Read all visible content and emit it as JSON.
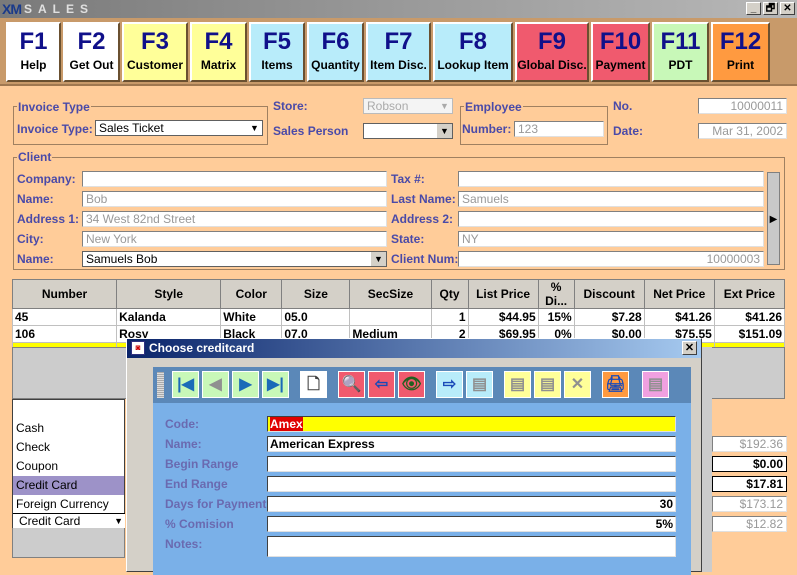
{
  "window": {
    "logo": "XM",
    "title": "SALES",
    "controls": [
      "_",
      "🗗",
      "✕"
    ]
  },
  "fkeys": [
    {
      "key": "F1",
      "label": "Help",
      "color": "#ffffff"
    },
    {
      "key": "F2",
      "label": "Get Out",
      "color": "#ffffff"
    },
    {
      "key": "F3",
      "label": "Customer",
      "color": "#ffff99"
    },
    {
      "key": "F4",
      "label": "Matrix",
      "color": "#ffff99"
    },
    {
      "key": "F5",
      "label": "Items",
      "color": "#b8ecfa"
    },
    {
      "key": "F6",
      "label": "Quantity",
      "color": "#b8ecfa"
    },
    {
      "key": "F7",
      "label": "Item Disc.",
      "color": "#b8ecfa"
    },
    {
      "key": "F8",
      "label": "Lookup Item",
      "color": "#b8ecfa"
    },
    {
      "key": "F9",
      "label": "Global Disc.",
      "color": "#f05a6e"
    },
    {
      "key": "F10",
      "label": "Payment",
      "color": "#f05a6e"
    },
    {
      "key": "F11",
      "label": "PDT",
      "color": "#c8f8b8"
    },
    {
      "key": "F12",
      "label": "Print",
      "color": "#ff9a40"
    }
  ],
  "header": {
    "invoice_group_title": "Invoice Type",
    "invoice_type_label": "Invoice Type:",
    "invoice_type_value": "Sales Ticket",
    "store_label": "Store:",
    "store_value": "Robson",
    "sales_person_label": "Sales Person",
    "sales_person_value": "",
    "employee_group_title": "Employee",
    "employee_number_label": "Number:",
    "employee_number_value": "123",
    "no_label": "No.",
    "no_value": "10000011",
    "date_label": "Date:",
    "date_value": "Mar 31, 2002"
  },
  "client": {
    "group_title": "Client",
    "company_label": "Company:",
    "company_value": "",
    "name_label": "Name:",
    "name_value": "Bob",
    "address1_label": "Address 1:",
    "address1_value": "34 West 82nd Street",
    "city_label": "City:",
    "city_value": "New York",
    "name_combo_label": "Name:",
    "name_combo_value": "Samuels Bob",
    "tax_label": "Tax #:",
    "tax_value": "",
    "last_name_label": "Last Name:",
    "last_name_value": "Samuels",
    "address2_label": "Address 2:",
    "address2_value": "",
    "state_label": "State:",
    "state_value": "NY",
    "client_num_label": "Client Num:",
    "client_num_value": "10000003"
  },
  "items_table": {
    "columns": [
      "Number",
      "Style",
      "Color",
      "Size",
      "SecSize",
      "Qty",
      "List Price",
      "% Di...",
      "Discount",
      "Net Price",
      "Ext Price"
    ],
    "rows": [
      [
        "45",
        "Kalanda",
        "White",
        "05.0",
        "",
        "1",
        "$44.95",
        "15%",
        "$7.28",
        "$41.26",
        "$41.26"
      ],
      [
        "106",
        "Rosy",
        "Black",
        "07.0",
        "Medium",
        "2",
        "$69.95",
        "0%",
        "$0.00",
        "$75.55",
        "$151.09"
      ]
    ]
  },
  "payment": {
    "options": [
      "Cash",
      "Check",
      "Coupon",
      "Credit Card",
      "Foreign Currency"
    ],
    "selected": "Credit Card"
  },
  "totals": [
    "$192.36",
    "$0.00",
    "$17.81",
    "$173.12",
    "$12.82"
  ],
  "dialog": {
    "title": "Choose creditcard",
    "close": "✕",
    "toolbar": [
      {
        "name": "first-record",
        "glyph": "|◀",
        "bg": "#c8f8b8",
        "fg": "#1a6ab8"
      },
      {
        "name": "previous-record",
        "glyph": "◀",
        "bg": "#c8f8b8",
        "fg": "#909090"
      },
      {
        "name": "next-record",
        "glyph": "▶",
        "bg": "#c8f8b8",
        "fg": "#1a6ab8"
      },
      {
        "name": "last-record",
        "glyph": "▶|",
        "bg": "#c8f8b8",
        "fg": "#1a6ab8"
      },
      {
        "name": "new-document",
        "glyph": "🗋",
        "bg": "#ffffff",
        "fg": "#404040"
      },
      {
        "name": "search",
        "glyph": "🔍",
        "bg": "#f05a6e",
        "fg": "#ffffff"
      },
      {
        "name": "exit",
        "glyph": "⇦",
        "bg": "#f05a6e",
        "fg": "#1a4ab8"
      },
      {
        "name": "view",
        "glyph": "👁",
        "bg": "#f05a6e",
        "fg": "#206020"
      },
      {
        "name": "import",
        "glyph": "⇨",
        "bg": "#b8ecfa",
        "fg": "#1a4ab8"
      },
      {
        "name": "copy-disabled",
        "glyph": "▤",
        "bg": "#b8ecfa",
        "fg": "#909090"
      },
      {
        "name": "save-disabled",
        "glyph": "▤",
        "bg": "#ffff99",
        "fg": "#909090"
      },
      {
        "name": "edit-disabled",
        "glyph": "▤",
        "bg": "#ffff99",
        "fg": "#909090"
      },
      {
        "name": "delete-disabled",
        "glyph": "✕",
        "bg": "#ffff99",
        "fg": "#909090"
      },
      {
        "name": "print",
        "glyph": "🖨",
        "bg": "#ff9a40",
        "fg": "#1a4ab8"
      },
      {
        "name": "report-disabled",
        "glyph": "▤",
        "bg": "#f0a0e0",
        "fg": "#909090"
      }
    ],
    "fields": [
      {
        "label": "Code:",
        "value": "Amex",
        "highlight": true
      },
      {
        "label": "Name:",
        "value": "American Express"
      },
      {
        "label": "Begin Range",
        "value": ""
      },
      {
        "label": "End Range",
        "value": ""
      },
      {
        "label": "Days for Payment",
        "value": "30",
        "align": "right"
      },
      {
        "label": "% Comision",
        "value": "5%",
        "align": "right"
      },
      {
        "label": "Notes:",
        "value": ""
      }
    ]
  }
}
